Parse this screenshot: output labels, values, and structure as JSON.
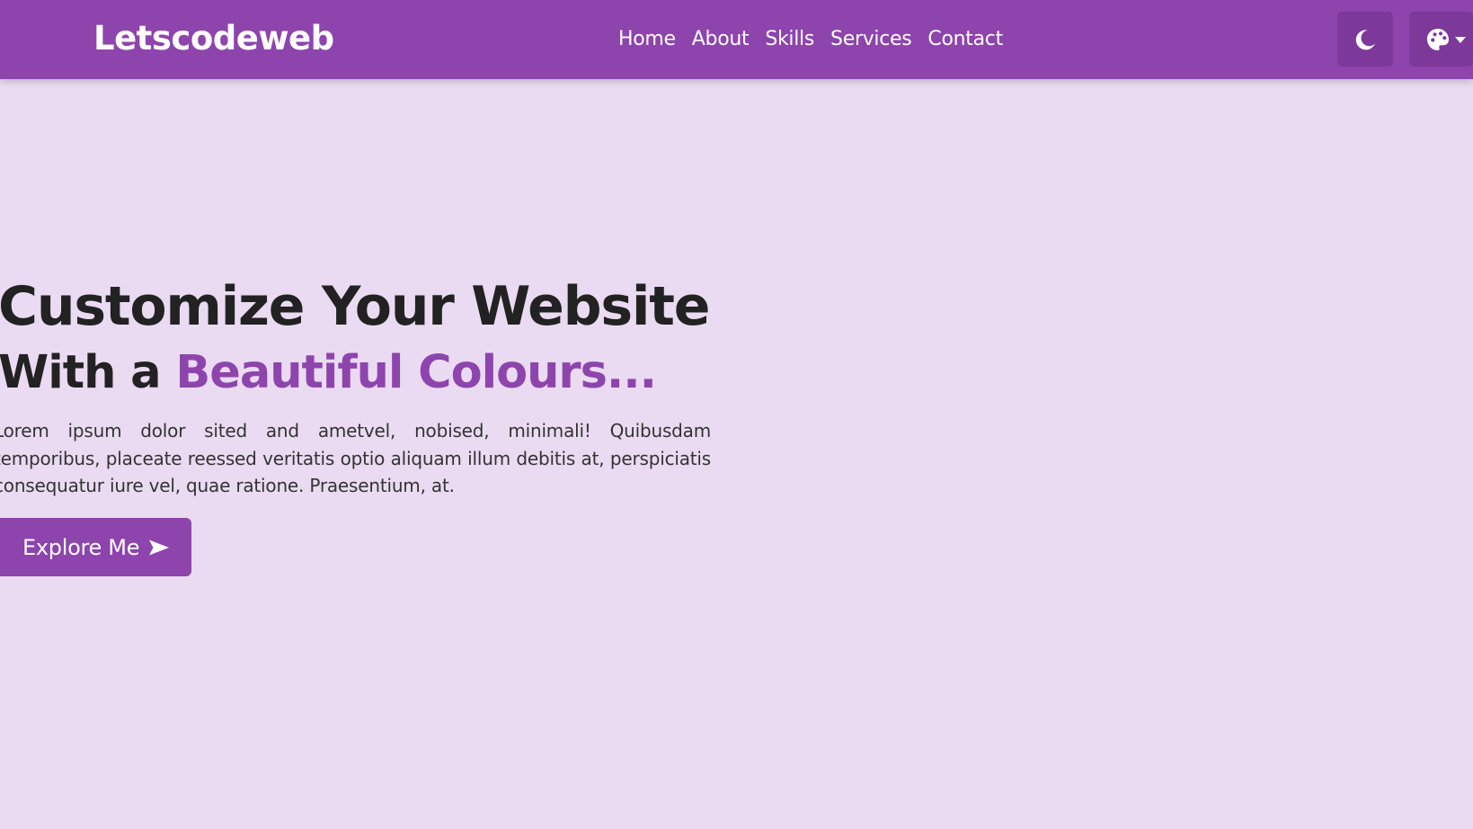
{
  "navbar": {
    "brand": "Letscodeweb",
    "links": [
      "Home",
      "About",
      "Skills",
      "Services",
      "Contact"
    ],
    "theme_toggle_icon": "moon-icon",
    "palette_icon": "palette-icon",
    "dropdown_icon": "caret-down-icon"
  },
  "hero": {
    "title": "Customize Your Website",
    "subtitle_prefix": "With a ",
    "subtitle_accent": "Beautiful Colours...",
    "text": "Lorem ipsum dolor sited and ametvel, nobised, minimali! Quibusdam temporibus, placeate reessed veritatis optio aliquam illum debitis at, perspiciatis consequatur iure vel, quae ratione. Praesentium, at.",
    "button_label": "Explore Me",
    "button_icon": "arrow-right-icon"
  },
  "colors": {
    "primary": "#8e44ad",
    "background": "#eadbf2",
    "heading": "#222222"
  }
}
